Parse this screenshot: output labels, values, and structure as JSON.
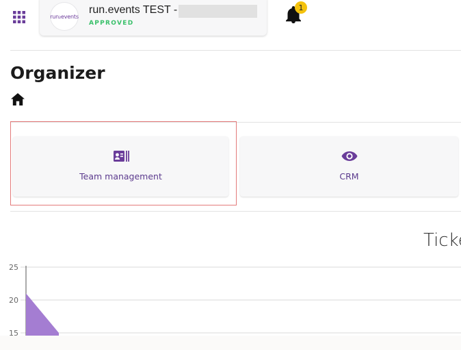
{
  "header": {
    "org_logo_text": "run₂events",
    "org_name": "run.events TEST -",
    "org_status": "APPROVED",
    "notifications_count": "1"
  },
  "page": {
    "title": "Organizer",
    "breadcrumb_icon": "home-icon"
  },
  "tiles": [
    {
      "label": "Team management",
      "icon": "contact-card-icon"
    },
    {
      "label": "CRM",
      "icon": "eye-icon"
    }
  ],
  "colors": {
    "accent": "#6a3d9a",
    "approved": "#3ac06a",
    "badge": "#f4c20d",
    "highlight_border": "#e37a7a",
    "chart_fill": "#a47dd2"
  },
  "chart_data": {
    "type": "area",
    "title": "Ticke",
    "y_ticks": [
      25,
      20,
      15
    ],
    "series": [
      {
        "values": [
          21,
          15
        ]
      }
    ]
  }
}
